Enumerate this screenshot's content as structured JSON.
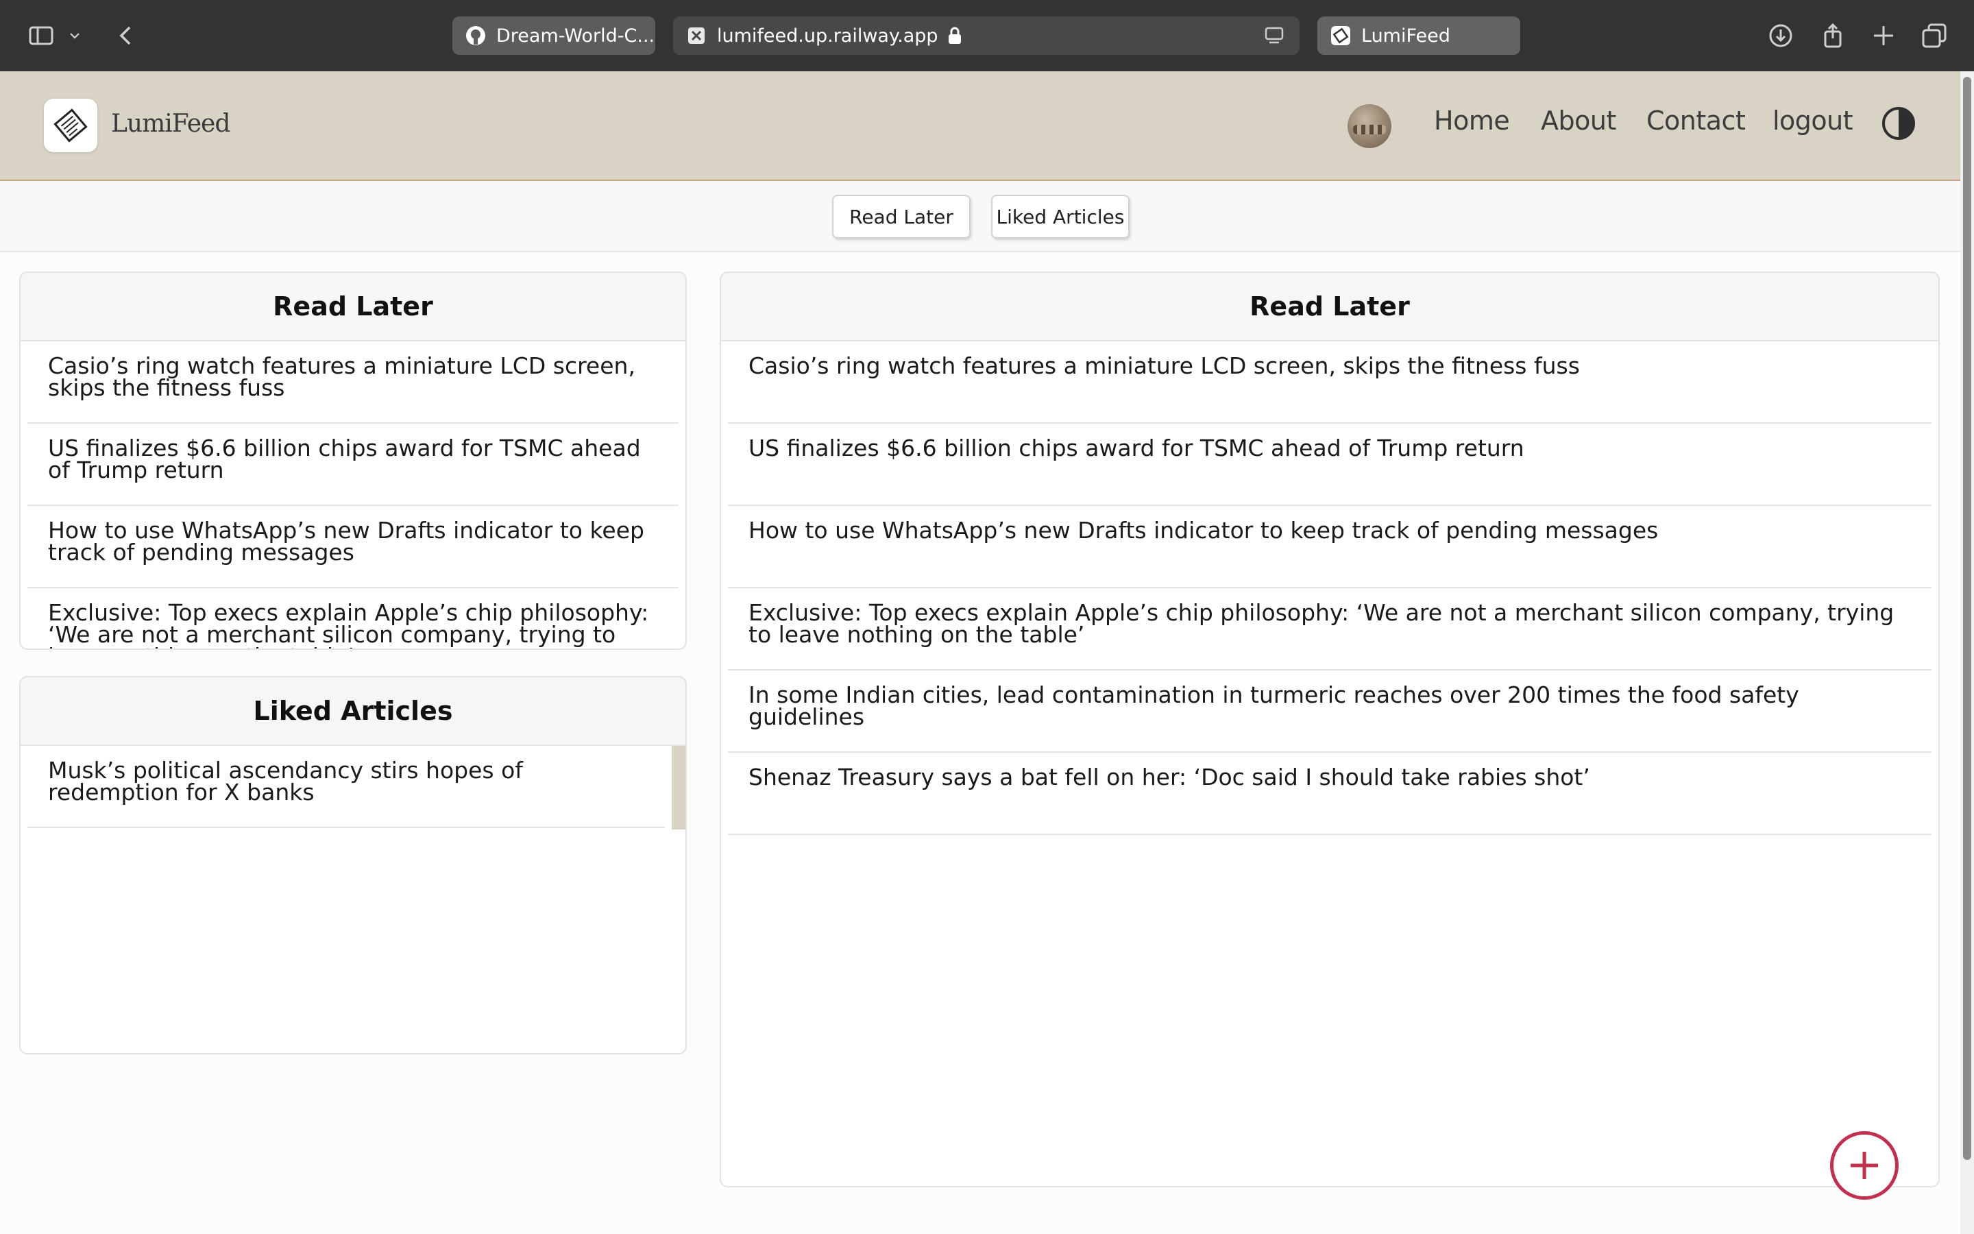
{
  "browser": {
    "tabs": [
      {
        "label": "Dream-World-C...",
        "icon": "github-icon"
      },
      {
        "label": "lumifeed.up.railway.app",
        "icon": "close-tab-icon"
      },
      {
        "label": "LumiFeed",
        "icon": "lumifeed-favicon"
      }
    ]
  },
  "header": {
    "brand": "LumiFeed",
    "nav": {
      "home": "Home",
      "about": "About",
      "contact": "Contact",
      "logout": "logout"
    }
  },
  "toolbar": {
    "read_later": "Read Later",
    "liked_articles": "Liked Articles"
  },
  "panels": {
    "read_later_small": {
      "title": "Read Later",
      "items": [
        "Casio’s ring watch features a miniature LCD screen, skips the fitness fuss",
        "US finalizes $6.6 billion chips award for TSMC ahead of Trump return",
        "How to use WhatsApp’s new Drafts indicator to keep track of pending messages",
        "Exclusive: Top execs explain Apple’s chip philosophy: ‘We are not a merchant silicon company, trying to leave nothing on the table’"
      ]
    },
    "liked": {
      "title": "Liked Articles",
      "items": [
        "Musk’s political ascendancy stirs hopes of redemption for X banks"
      ]
    },
    "read_later_main": {
      "title": "Read Later",
      "items": [
        "Casio’s ring watch features a miniature LCD screen, skips the fitness fuss",
        "US finalizes $6.6 billion chips award for TSMC ahead of Trump return",
        "How to use WhatsApp’s new Drafts indicator to keep track of pending messages",
        "Exclusive: Top execs explain Apple’s chip philosophy: ‘We are not a merchant silicon company, trying to leave nothing on the table’",
        "In some Indian cities, lead contamination in turmeric reaches over 200 times the food safety guidelines",
        "Shenaz Treasury says a bat fell on her: ‘Doc said I should take rabies shot’"
      ]
    }
  },
  "colors": {
    "header_bg": "#d9d3c6",
    "accent_red": "#c0314e",
    "chrome_bg": "#333335"
  }
}
